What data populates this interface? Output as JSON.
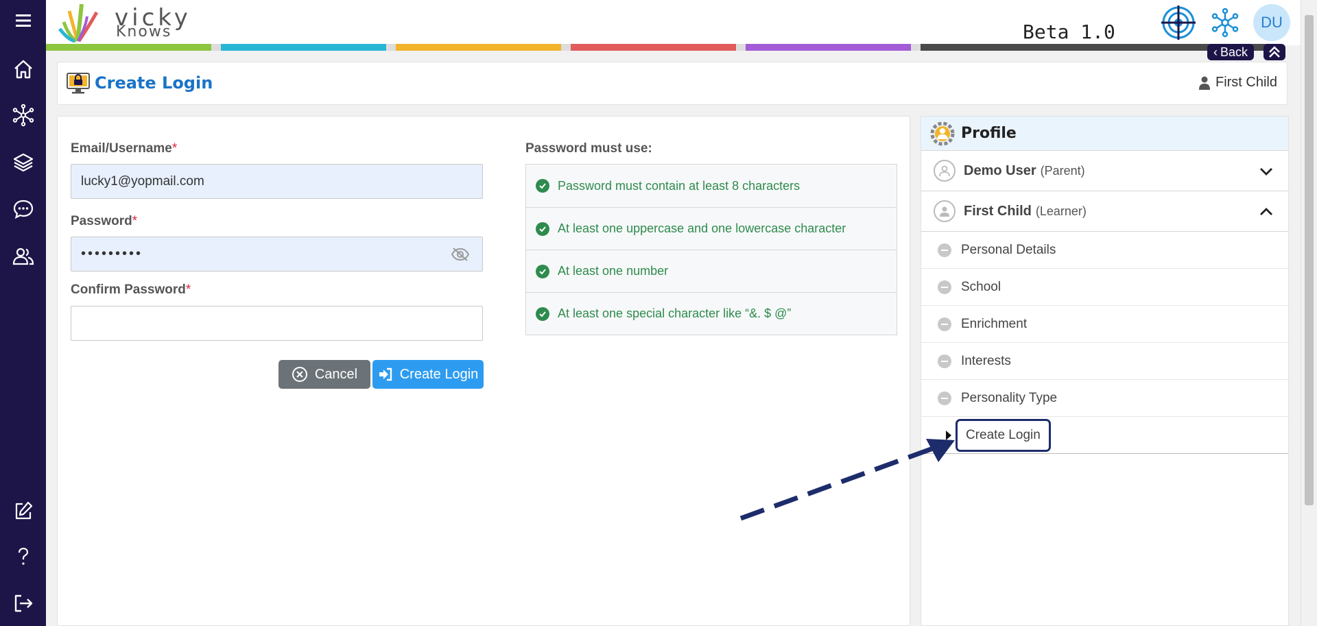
{
  "app": {
    "logo_line1": "vicky",
    "logo_line2": "Knows",
    "version": "Beta 1.0",
    "avatar_initials": "DU",
    "back_label": "Back"
  },
  "colors": {
    "sidebar": "#1d1548",
    "accent": "#2d9cf0",
    "title": "#1a73c7",
    "success": "#2e8b4e",
    "colorbar": [
      "#8dc63f",
      "#29b6d5",
      "#f2b42c",
      "#e15b5b",
      "#a35bd6",
      "#4a4a4a"
    ]
  },
  "sidebar": {
    "items": [
      {
        "name": "menu-icon"
      },
      {
        "name": "home-icon"
      },
      {
        "name": "network-icon"
      },
      {
        "name": "layers-icon"
      },
      {
        "name": "chat-icon"
      },
      {
        "name": "users-icon"
      },
      {
        "name": "edit-icon"
      },
      {
        "name": "help-icon"
      },
      {
        "name": "logout-icon"
      }
    ]
  },
  "page": {
    "title": "Create Login",
    "current_user": "First Child"
  },
  "form": {
    "email_label": "Email/Username",
    "email_value": "lucky1@yopmail.com",
    "password_label": "Password",
    "password_value": "•••••••••",
    "confirm_label": "Confirm Password",
    "confirm_value": "",
    "required_mark": "*",
    "cancel_label": "Cancel",
    "create_label": "Create Login"
  },
  "password_rules": {
    "title": "Password must use:",
    "items": [
      "Password must contain at least 8 characters",
      "At least one uppercase and one lowercase character",
      "At least one number",
      "At least one special character like “&. $ @”"
    ]
  },
  "profile": {
    "title": "Profile",
    "accounts": [
      {
        "name": "Demo User",
        "role": "(Parent)",
        "expanded": false
      },
      {
        "name": "First Child",
        "role": "(Learner)",
        "expanded": true
      }
    ],
    "sub_items": [
      "Personal Details",
      "School",
      "Enrichment",
      "Interests",
      "Personality Type",
      "Create Login"
    ]
  }
}
